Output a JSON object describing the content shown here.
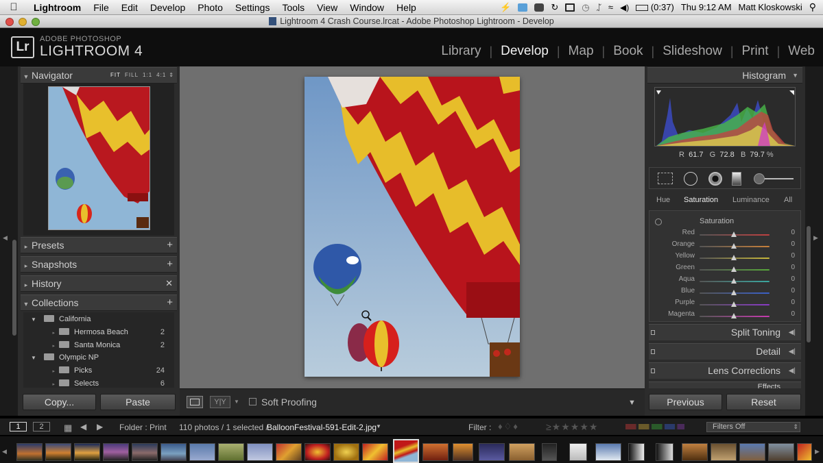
{
  "menubar": {
    "apple": "",
    "app_name": "Lightroom",
    "items": [
      "File",
      "Edit",
      "Develop",
      "Photo",
      "Settings",
      "Tools",
      "View",
      "Window",
      "Help"
    ],
    "battery": "(0:37)",
    "clock": "Thu 9:12 AM",
    "user": "Matt Kloskowski"
  },
  "window": {
    "title": "Lightroom 4 Crash Course.lrcat - Adobe Photoshop Lightroom - Develop"
  },
  "brand": {
    "badge": "Lr",
    "small": "ADOBE PHOTOSHOP",
    "big": "LIGHTROOM 4"
  },
  "modules": [
    {
      "label": "Library",
      "active": false
    },
    {
      "label": "Develop",
      "active": true
    },
    {
      "label": "Map",
      "active": false
    },
    {
      "label": "Book",
      "active": false
    },
    {
      "label": "Slideshow",
      "active": false
    },
    {
      "label": "Print",
      "active": false
    },
    {
      "label": "Web",
      "active": false
    }
  ],
  "left": {
    "navigator": {
      "title": "Navigator",
      "zoom": [
        "FIT",
        "FILL",
        "1:1",
        "4:1"
      ]
    },
    "presets": "Presets",
    "snapshots": "Snapshots",
    "history": "History",
    "collections": {
      "title": "Collections",
      "items": [
        {
          "name": "California",
          "count": "",
          "level": 0
        },
        {
          "name": "Hermosa Beach",
          "count": "2",
          "level": 1
        },
        {
          "name": "Santa Monica",
          "count": "2",
          "level": 1
        },
        {
          "name": "Olympic NP",
          "count": "",
          "level": 0
        },
        {
          "name": "Picks",
          "count": "24",
          "level": 1
        },
        {
          "name": "Selects",
          "count": "6",
          "level": 1
        }
      ]
    },
    "copy_button": "Copy...",
    "paste_button": "Paste"
  },
  "toolbar": {
    "soft_proofing": "Soft Proofing",
    "yy": "Y|Y"
  },
  "right": {
    "histogram": {
      "title": "Histogram",
      "r_label": "R",
      "r_value": "61.7",
      "g_label": "G",
      "g_value": "72.8",
      "b_label": "B",
      "b_value": "79.7",
      "pct": "%"
    },
    "hsl": {
      "tabs": [
        "Hue",
        "Saturation",
        "Luminance",
        "All"
      ],
      "active_tab": "Saturation",
      "section": "Saturation",
      "sliders": [
        {
          "label": "Red",
          "value": "0",
          "color": "#c04040"
        },
        {
          "label": "Orange",
          "value": "0",
          "color": "#c8803a"
        },
        {
          "label": "Yellow",
          "value": "0",
          "color": "#c8b83a"
        },
        {
          "label": "Green",
          "value": "0",
          "color": "#58a83a"
        },
        {
          "label": "Aqua",
          "value": "0",
          "color": "#3aa8a0"
        },
        {
          "label": "Blue",
          "value": "0",
          "color": "#3a60c8"
        },
        {
          "label": "Purple",
          "value": "0",
          "color": "#8a3ac8"
        },
        {
          "label": "Magenta",
          "value": "0",
          "color": "#c83ab0"
        }
      ]
    },
    "split_toning": "Split Toning",
    "detail": "Detail",
    "lens_corrections": "Lens Corrections",
    "effects": "Effects",
    "previous_button": "Previous",
    "reset_button": "Reset"
  },
  "filmstrip": {
    "page1": "1",
    "page2": "2",
    "folder": "Folder : Print",
    "count": "110 photos / 1 selected /",
    "filename": "BalloonFestival-591-Edit-2.jpg",
    "filter_label": "Filter :",
    "filters_off": "Filters Off"
  },
  "colors": {
    "accent": "#f2f2f2",
    "panel": "#2c2c2c",
    "center": "#6f6f6f"
  }
}
